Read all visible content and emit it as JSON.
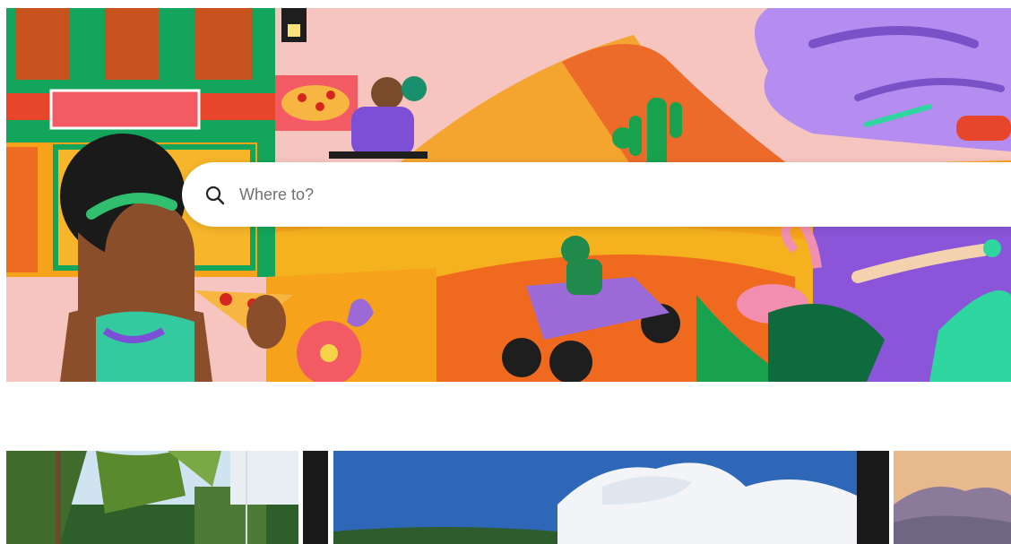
{
  "search": {
    "placeholder": "Where to?"
  },
  "colors": {
    "hero_background": "#f7c5c0",
    "search_background": "#ffffff",
    "placeholder_text": "#717171"
  },
  "icons": {
    "search": "search-icon"
  },
  "photos": [
    {
      "name": "tropical-palms-photo"
    },
    {
      "name": "island-sky-photo"
    },
    {
      "name": "mountain-vista-photo"
    }
  ]
}
